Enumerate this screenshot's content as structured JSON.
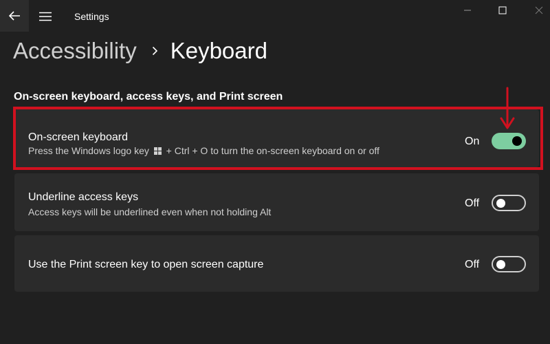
{
  "app": {
    "title": "Settings"
  },
  "header": {
    "parent": "Accessibility",
    "current": "Keyboard"
  },
  "section": {
    "title": "On-screen keyboard, access keys, and Print screen"
  },
  "settings": [
    {
      "title": "On-screen keyboard",
      "desc_before": "Press the Windows logo key",
      "desc_after": "+ Ctrl + O to turn the on-screen keyboard on or off",
      "state": "On",
      "enabled": true
    },
    {
      "title": "Underline access keys",
      "desc": "Access keys will be underlined even when not holding Alt",
      "state": "Off",
      "enabled": false
    },
    {
      "title": "Use the Print screen key to open screen capture",
      "state": "Off",
      "enabled": false
    }
  ],
  "colors": {
    "background": "#202020",
    "card": "#2b2b2b",
    "toggle_on": "#7dcea0",
    "annotation": "#d1111f"
  },
  "icons": [
    "back-arrow-icon",
    "hamburger-menu-icon",
    "minimize-icon",
    "maximize-icon",
    "close-icon",
    "chevron-right-icon",
    "windows-logo-icon"
  ]
}
